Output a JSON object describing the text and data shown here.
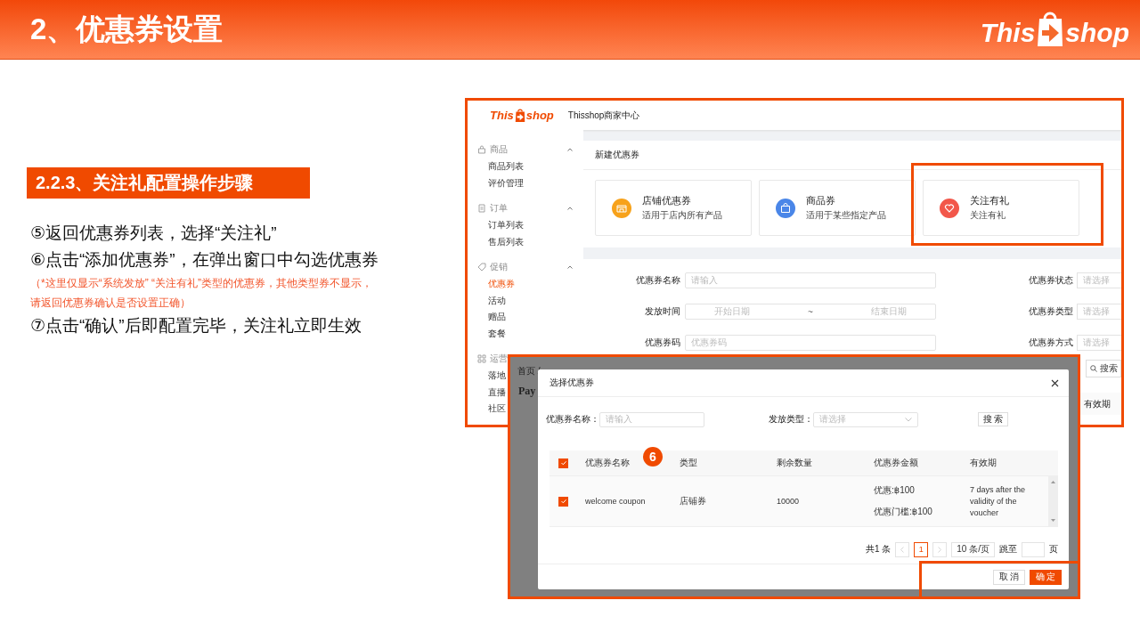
{
  "header": {
    "title": "2、优惠券设置",
    "logo": {
      "left": "This",
      "right": "shop"
    }
  },
  "section_title": "2.2.3、关注礼配置操作步骤",
  "steps": [
    {
      "kind": "step",
      "text": "⑤返回优惠券列表，选择“关注礼”"
    },
    {
      "kind": "step",
      "text": "⑥点击“添加优惠券”，在弹出窗口中勾选优惠券"
    },
    {
      "kind": "note",
      "text": "（*这里仅显示“系统发放” “关注有礼”类型的优惠券，其他类型券不显示，"
    },
    {
      "kind": "note",
      "text": "请返回优惠券确认是否设置正确）"
    },
    {
      "kind": "step",
      "text": "⑦点击“确认”后即配置完毕，关注礼立即生效"
    }
  ],
  "merchant_screen": {
    "logo": {
      "left": "This",
      "right": "shop"
    },
    "app_title": "Thisshop商家中心",
    "sidebar": [
      {
        "label": "商品",
        "expanded": true,
        "children": [
          {
            "label": "商品列表",
            "selected": false
          },
          {
            "label": "评价管理",
            "selected": false
          }
        ]
      },
      {
        "label": "订单",
        "expanded": true,
        "children": [
          {
            "label": "订单列表",
            "selected": false
          },
          {
            "label": "售后列表",
            "selected": false
          }
        ]
      },
      {
        "label": "促销",
        "expanded": true,
        "children": [
          {
            "label": "优惠券",
            "selected": true
          },
          {
            "label": "活动",
            "selected": false
          },
          {
            "label": "赠品",
            "selected": false
          },
          {
            "label": "套餐",
            "selected": false
          }
        ]
      },
      {
        "label": "运营",
        "children": [
          {
            "label": "落地",
            "selected": false
          },
          {
            "label": "直播",
            "selected": false
          },
          {
            "label": "社区",
            "selected": false
          }
        ]
      }
    ],
    "panel_title": "新建优惠券",
    "coupon_types": [
      {
        "name": "店铺优惠券",
        "desc": "适用于店内所有产品",
        "color": "#f7a21b",
        "highlighted": false
      },
      {
        "name": "商品券",
        "desc": "适用于某些指定产品",
        "color": "#4a86e8",
        "highlighted": false
      },
      {
        "name": "关注有礼",
        "desc": "关注有礼",
        "color": "#f2574a",
        "highlighted": true
      }
    ],
    "filters": [
      {
        "kind": "input",
        "label": "优惠券名称",
        "placeholder": "请输入",
        "side_label": "优惠券状态",
        "side_placeholder": "请选择"
      },
      {
        "kind": "daterange",
        "label": "发放时间",
        "start": "开始日期",
        "separator": "~",
        "end": "结束日期",
        "side_label": "优惠券类型",
        "side_placeholder": "请选择"
      },
      {
        "kind": "input",
        "label": "优惠券码",
        "placeholder": "优惠券码",
        "side_label": "优惠券方式",
        "side_placeholder": "请选择"
      }
    ],
    "search_button": "搜索",
    "table_last_column": "有效期"
  },
  "dialog_screen": {
    "breadcrumb": "首页 /",
    "page_title": "Pay",
    "title": "选择优惠券",
    "filters": [
      {
        "kind": "input",
        "label": "优惠券名称：",
        "placeholder": "请输入"
      },
      {
        "kind": "select",
        "label": "发放类型：",
        "placeholder": "请选择"
      }
    ],
    "search_button": "搜 索",
    "step_marker": "6",
    "columns": [
      "优惠券名称",
      "类型",
      "剩余数量",
      "优惠券金额",
      "有效期"
    ],
    "all_checked": true,
    "rows": [
      {
        "checked": true,
        "name": "welcome coupon",
        "type": "店铺券",
        "remaining": "10000",
        "amount": [
          "优惠:฿100",
          "优惠门槛:฿100"
        ],
        "validity": "7 days after the validity of the voucher"
      }
    ],
    "pagination": {
      "total": "共1 条",
      "pages": [
        {
          "label": "1",
          "selected": true
        }
      ],
      "page_size": "10 条/页",
      "jump_label": "跳至",
      "page_suffix": "页"
    },
    "footer_highlighted": true,
    "buttons": [
      {
        "kind": "secondary",
        "label": "取 消"
      },
      {
        "kind": "primary",
        "label": "确 定"
      }
    ]
  }
}
